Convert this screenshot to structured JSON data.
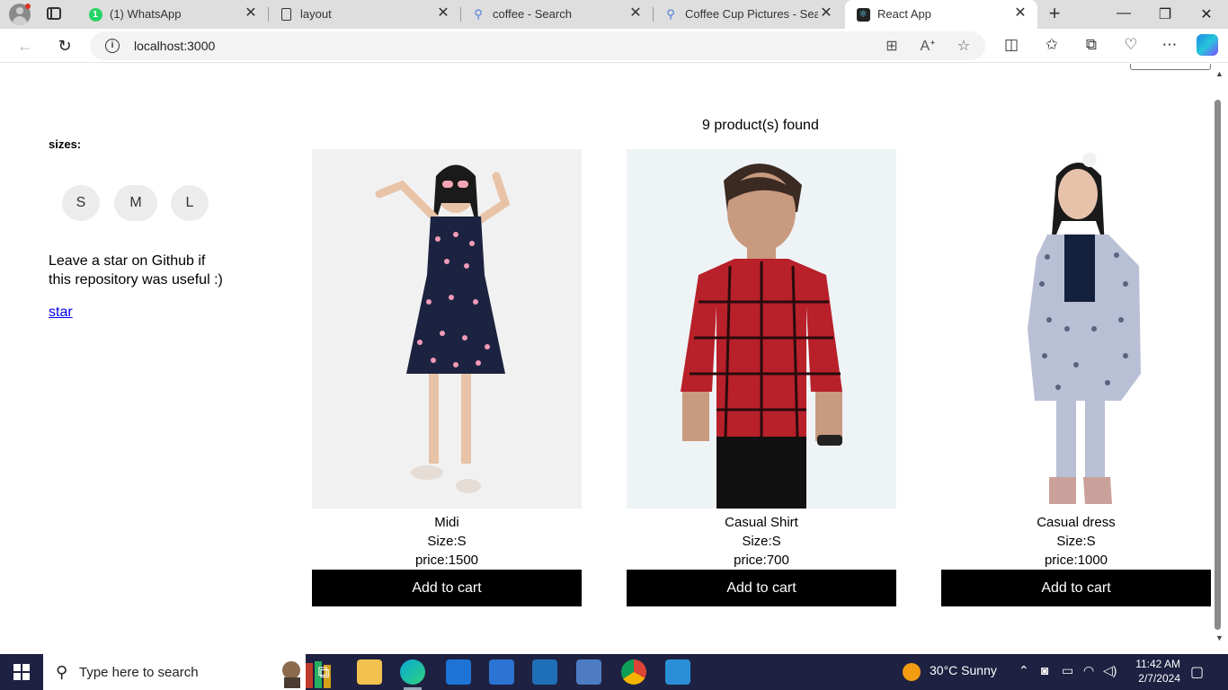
{
  "browser": {
    "tabs": [
      {
        "title": "(1) WhatsApp",
        "favicon": "whatsapp-icon",
        "badge": "1"
      },
      {
        "title": "layout",
        "favicon": "document-icon"
      },
      {
        "title": "coffee - Search",
        "favicon": "search-icon"
      },
      {
        "title": "Coffee Cup Pictures - Search",
        "favicon": "search-icon"
      },
      {
        "title": "React App",
        "favicon": "react-icon",
        "active": true
      }
    ],
    "url": "localhost:3000"
  },
  "sidebar": {
    "sizes_label": "sizes:",
    "sizes": [
      "S",
      "M",
      "L"
    ],
    "star_text": "Leave a star on Github if this repository was useful :)",
    "star_link": "star"
  },
  "main": {
    "found_text": "9 product(s) found",
    "products": [
      {
        "name": "Midi",
        "size": "Size:S",
        "price": "price:1500",
        "cta": "Add to cart"
      },
      {
        "name": "Casual Shirt",
        "size": "Size:S",
        "price": "price:700",
        "cta": "Add to cart"
      },
      {
        "name": "Casual dress",
        "size": "Size:S",
        "price": "price:1000",
        "cta": "Add to cart"
      }
    ]
  },
  "taskbar": {
    "search_placeholder": "Type here to search",
    "weather": "30°C  Sunny",
    "time": "11:42 AM",
    "date": "2/7/2024"
  },
  "colors": {
    "tabstrip": "#dedede",
    "button_bg": "#000000",
    "size_circle": "#ececec",
    "link": "#0000ee",
    "taskbar": "#1f2142"
  }
}
